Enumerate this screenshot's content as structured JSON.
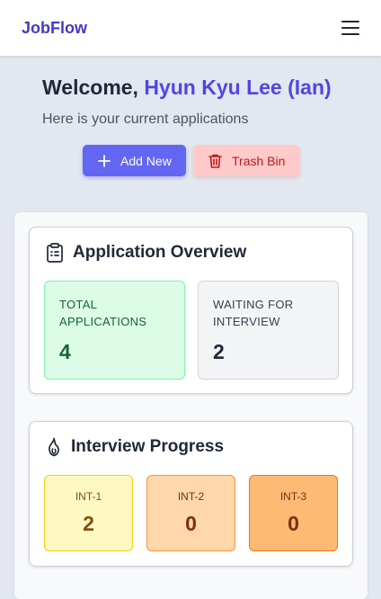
{
  "navbar": {
    "brand": "JobFlow",
    "menu_icon": "hamburger-menu-icon"
  },
  "hero": {
    "welcome_prefix": "Welcome, ",
    "user_name": "Hyun Kyu Lee (Ian)",
    "subtitle": "Here is your current applications"
  },
  "actions": {
    "add_label": "Add New",
    "add_icon": "plus-icon",
    "trash_label": "Trash Bin",
    "trash_icon": "trash-icon"
  },
  "overview": {
    "title": "Application Overview",
    "icon": "clipboard-list-icon",
    "stats": [
      {
        "label": "Total Applications",
        "value": "4"
      },
      {
        "label": "Waiting for Interview",
        "value": "2"
      }
    ]
  },
  "progress": {
    "title": "Interview Progress",
    "icon": "flame-icon",
    "stages": [
      {
        "label": "INT-1",
        "value": "2"
      },
      {
        "label": "INT-2",
        "value": "0"
      },
      {
        "label": "INT-3",
        "value": "0"
      }
    ]
  },
  "colors": {
    "brand": "#4338ca",
    "accent": "#6366f1",
    "trash_bg": "#fecaca",
    "trash_text": "#b91c1c"
  }
}
